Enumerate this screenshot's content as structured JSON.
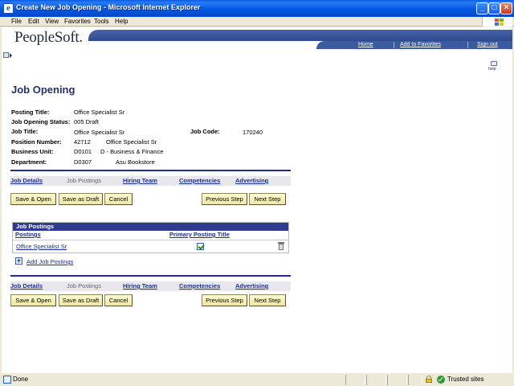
{
  "window": {
    "title": "Create New Job Opening - Microsoft Internet Explorer",
    "controls": [
      "_",
      "□",
      "×"
    ]
  },
  "menubar": {
    "items": [
      "File",
      "Edit",
      "View",
      "Favorites",
      "Tools",
      "Help"
    ]
  },
  "header": {
    "logo": "PeopleSoft.",
    "nav": [
      "Home",
      "Add to Favorites",
      "Sign out"
    ],
    "help_label": "help"
  },
  "page": {
    "title": "Job Opening"
  },
  "fields": {
    "posting_title_label": "Posting Title:",
    "posting_title_value": "Office Specialist Sr",
    "status_label": "Job Opening Status:",
    "status_value": "005 Draft",
    "job_title_label": "Job Title:",
    "job_title_value": "Office Specialist Sr",
    "job_code_label": "Job Code:",
    "job_code_value": "170240",
    "position_label": "Position Number:",
    "position_number": "42712",
    "position_desc": "Office Specialist Sr",
    "business_unit_label": "Business Unit:",
    "business_unit_code": "D0101",
    "business_unit_desc": "D - Business & Finance",
    "department_label": "Department:",
    "department_code": "D0307",
    "department_desc": "Asu Bookstore"
  },
  "tabs": {
    "job_details": "Job Details",
    "job_postings": "Job Postings",
    "hiring_team": "Hiring Team",
    "competencies": "Competencies",
    "advertising": "Advertising"
  },
  "buttons": {
    "save_open": "Save & Open",
    "save_draft": "Save as Draft",
    "cancel": "Cancel",
    "previous_step": "Previous Step",
    "next_step": "Next Step"
  },
  "postings_grid": {
    "title": "Job Postings",
    "col_postings": "Postings",
    "col_primary": "Primary Posting Title",
    "rows": [
      {
        "posting": "Office Specialist Sr",
        "primary": true
      }
    ],
    "add_link": "Add Job Postings"
  },
  "statusbar": {
    "status": "Done",
    "zone": "Trusted sites"
  },
  "colors": {
    "title_blue": "#24336b",
    "link_blue": "#1a2e9a",
    "grid_header": "#2e3b8f",
    "button_yellow": "#fdfbd0"
  }
}
